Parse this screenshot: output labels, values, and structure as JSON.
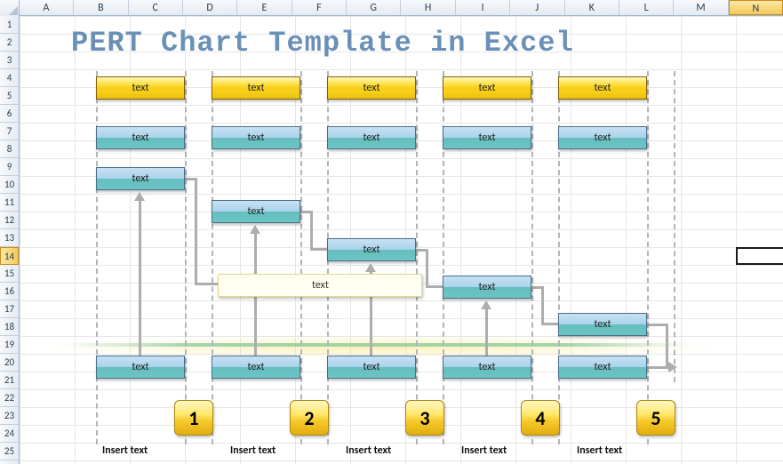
{
  "columns": [
    "A",
    "B",
    "C",
    "D",
    "E",
    "F",
    "G",
    "H",
    "I",
    "J",
    "K",
    "L",
    "M",
    "N"
  ],
  "rows": [
    "1",
    "2",
    "3",
    "4",
    "5",
    "6",
    "7",
    "8",
    "9",
    "10",
    "11",
    "12",
    "13",
    "14",
    "15",
    "16",
    "17",
    "18",
    "19",
    "20",
    "21",
    "22",
    "23",
    "24",
    "25"
  ],
  "active": {
    "col": "N",
    "row": "14"
  },
  "title": "PERT Chart Template in Excel",
  "row_yellow": [
    "text",
    "text",
    "text",
    "text",
    "text"
  ],
  "row_blue1": [
    "text",
    "text",
    "text",
    "text",
    "text"
  ],
  "cascade": [
    "text",
    "text",
    "text",
    "text",
    "text"
  ],
  "wide_label": "text",
  "row_blue2": [
    "text",
    "text",
    "text",
    "text",
    "text"
  ],
  "numbers": [
    "1",
    "2",
    "3",
    "4",
    "5"
  ],
  "inserts": [
    "Insert text",
    "Insert text",
    "Insert text",
    "Insert text",
    "Insert text"
  ],
  "chart_data": {
    "type": "table",
    "title": "PERT Chart Template in Excel",
    "phases": [
      {
        "id": 1,
        "header": "text",
        "sub": "text",
        "task": "text",
        "footer": "text",
        "caption": "Insert text"
      },
      {
        "id": 2,
        "header": "text",
        "sub": "text",
        "task": "text",
        "footer": "text",
        "caption": "Insert text"
      },
      {
        "id": 3,
        "header": "text",
        "sub": "text",
        "task": "text",
        "footer": "text",
        "caption": "Insert text"
      },
      {
        "id": 4,
        "header": "text",
        "sub": "text",
        "task": "text",
        "footer": "text",
        "caption": "Insert text"
      },
      {
        "id": 5,
        "header": "text",
        "sub": "text",
        "task": "text",
        "footer": "text",
        "caption": "Insert text"
      }
    ],
    "spanning_label": "text"
  }
}
